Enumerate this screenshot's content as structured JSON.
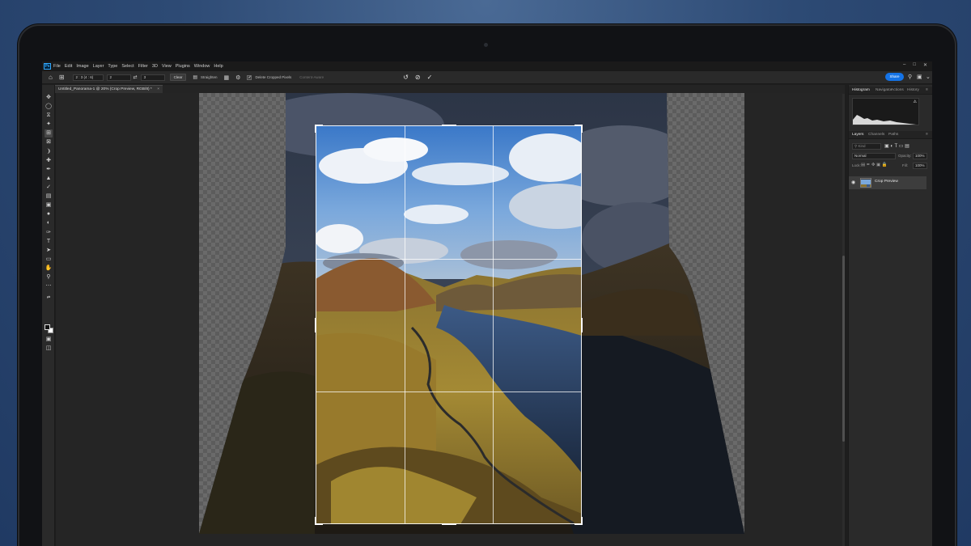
{
  "app": {
    "logo": "Ps",
    "menu": [
      "File",
      "Edit",
      "Image",
      "Layer",
      "Type",
      "Select",
      "Filter",
      "3D",
      "View",
      "Plugins",
      "Window",
      "Help"
    ]
  },
  "options_bar": {
    "ratio_preset": "2 : 3 (4 : 6)",
    "width_value": "2",
    "height_value": "3",
    "clear_label": "Clear",
    "straighten_label": "Straighten",
    "delete_cropped_label": "Delete Cropped Pixels",
    "delete_cropped_checked": true,
    "content_aware_label": "Content-Aware",
    "share_label": "Share"
  },
  "document": {
    "tab_title": "Untitled_Panorama-1 @ 20% (Crop Preview, RGB/8) *"
  },
  "panels": {
    "top_tabs": [
      "Histogram",
      "Navigator",
      "Actions",
      "History"
    ],
    "layer_tabs": [
      "Layers",
      "Channels",
      "Paths"
    ],
    "kind_placeholder": "Kind",
    "blend_mode": "Normal",
    "opacity_label": "Opacity:",
    "opacity_value": "100%",
    "lock_label": "Lock:",
    "fill_label": "Fill:",
    "fill_value": "100%",
    "layer_name": "Crop Preview"
  },
  "colors": {
    "share_button": "#1473e6",
    "background": "#2d4a74"
  }
}
